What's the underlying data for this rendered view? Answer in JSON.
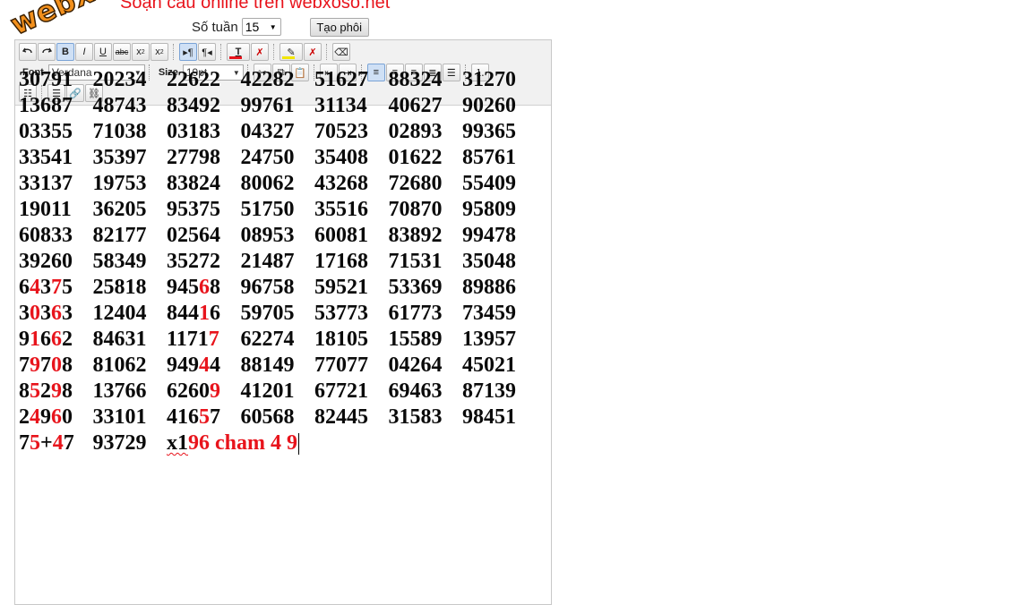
{
  "page": {
    "title": "Soạn cầu online trên webxoso.net"
  },
  "controls": {
    "weeks_label": "Số tuần",
    "weeks_value": "15",
    "generate_label": "Tạo phôi"
  },
  "toolbar": {
    "font_label": "Font",
    "font_value": "Verdana",
    "size_label": "Size",
    "size_value": "19pt",
    "text_color": "#e8141c",
    "highlight_color": "#f2e600"
  },
  "watermark": {
    "text": "webxoso.net"
  },
  "results": [
    [
      "30791",
      "20234",
      "22622",
      "42282",
      "51627",
      "88324",
      "31270"
    ],
    [
      "13687",
      "48743",
      "83492",
      "99761",
      "31134",
      "40627",
      "90260"
    ],
    [
      "03355",
      "71038",
      "03183",
      "04327",
      "70523",
      "02893",
      "99365"
    ],
    [
      "33541",
      "35397",
      "27798",
      "24750",
      "35408",
      "01622",
      "85761"
    ],
    [
      "33137",
      "19753",
      "83824",
      "80062",
      "43268",
      "72680",
      "55409"
    ],
    [
      "19011",
      "36205",
      "95375",
      "51750",
      "35516",
      "70870",
      "95809"
    ],
    [
      "60833",
      "82177",
      "02564",
      "08953",
      "60081",
      "83892",
      "99478"
    ],
    [
      "39260",
      "58349",
      "35272",
      "21487",
      "17168",
      "71531",
      "35048"
    ],
    [
      "64375",
      "25818",
      "94568",
      "96758",
      "59521",
      "53369",
      "89886"
    ],
    [
      "30363",
      "12404",
      "84416",
      "59705",
      "53773",
      "61773",
      "73459"
    ],
    [
      "91662",
      "84631",
      "11717",
      "62274",
      "18105",
      "15589",
      "13957"
    ],
    [
      "79708",
      "81062",
      "94944",
      "88149",
      "77077",
      "04264",
      "45021"
    ],
    [
      "85298",
      "13766",
      "62609",
      "41201",
      "67721",
      "69463",
      "87139"
    ],
    [
      "24960",
      "33101",
      "41657",
      "60568",
      "82445",
      "31583",
      "98451"
    ]
  ],
  "highlights": [
    {
      "row": 8,
      "col": 0,
      "positions": [
        1,
        3
      ]
    },
    {
      "row": 8,
      "col": 2,
      "positions": [
        3
      ]
    },
    {
      "row": 9,
      "col": 0,
      "positions": [
        1,
        3
      ]
    },
    {
      "row": 9,
      "col": 2,
      "positions": [
        3
      ]
    },
    {
      "row": 10,
      "col": 0,
      "positions": [
        1,
        3
      ]
    },
    {
      "row": 10,
      "col": 2,
      "positions": [
        4
      ]
    },
    {
      "row": 11,
      "col": 0,
      "positions": [
        1,
        3
      ]
    },
    {
      "row": 11,
      "col": 2,
      "positions": [
        3
      ]
    },
    {
      "row": 12,
      "col": 0,
      "positions": [
        1,
        3
      ]
    },
    {
      "row": 12,
      "col": 2,
      "positions": [
        4
      ]
    },
    {
      "row": 13,
      "col": 0,
      "positions": [
        1,
        3
      ]
    },
    {
      "row": 13,
      "col": 2,
      "positions": [
        3
      ]
    }
  ],
  "last_line": {
    "cells": [
      [
        {
          "t": "7"
        },
        {
          "t": "5",
          "red": true
        },
        {
          "t": "+"
        },
        {
          "t": "4",
          "red": true
        },
        {
          "t": "7"
        }
      ],
      [
        {
          "t": "93729"
        }
      ],
      [
        {
          "t": "x1",
          "spell": true
        },
        {
          "t": "96 cham 4 9",
          "red": true
        }
      ]
    ]
  }
}
